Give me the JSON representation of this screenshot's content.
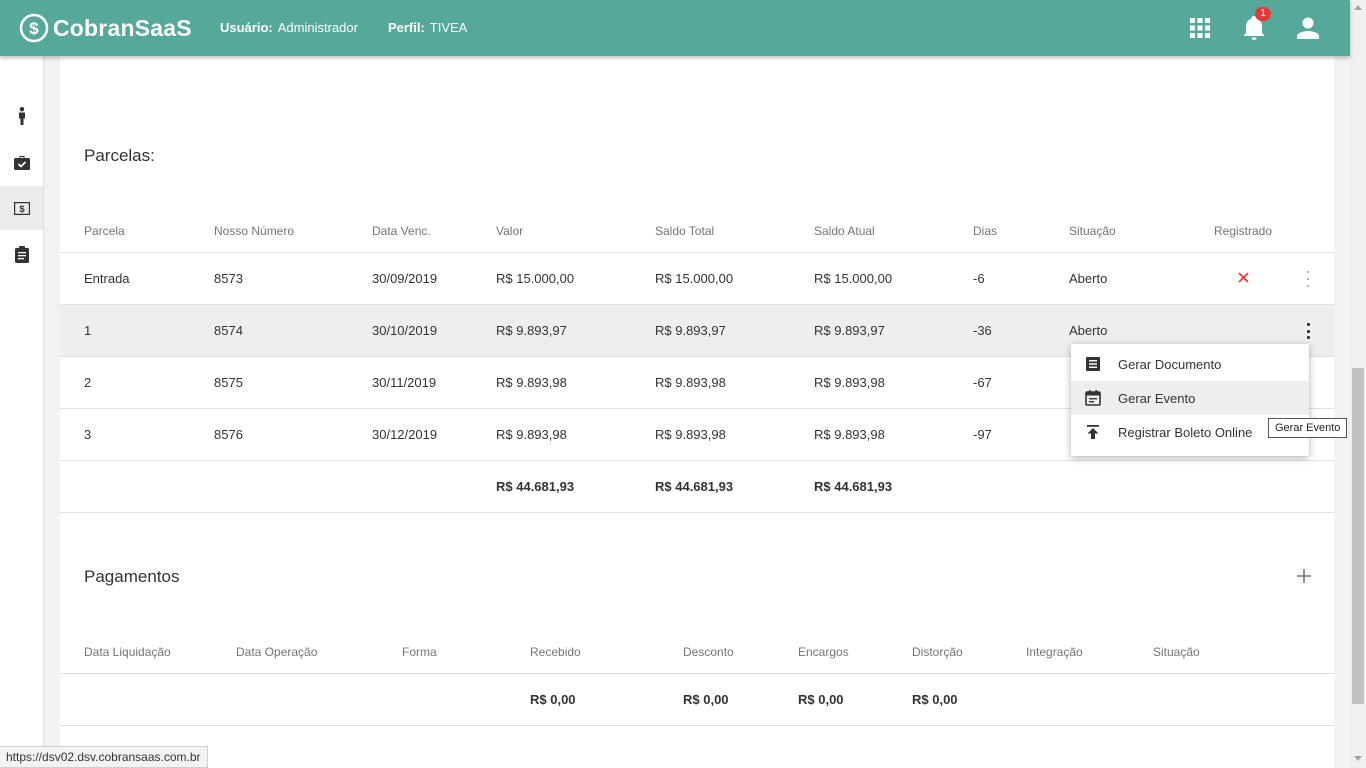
{
  "app": {
    "brand": "CobranSaaS",
    "user_label": "Usuário:",
    "user_value": "Administrador",
    "profile_label": "Perfil:",
    "profile_value": "TIVEA",
    "notifications_count": "1"
  },
  "colors": {
    "brand": "#56a89a",
    "badge": "#e53935",
    "error_x": "#e53935"
  },
  "sidebar": {
    "items": [
      {
        "icon": "person-icon"
      },
      {
        "icon": "briefcase-check-icon"
      },
      {
        "icon": "money-icon",
        "active": true
      },
      {
        "icon": "clipboard-icon"
      }
    ]
  },
  "parcelas": {
    "title": "Parcelas:",
    "headers": [
      "Parcela",
      "Nosso Número",
      "Data Venc.",
      "Valor",
      "Saldo Total",
      "Saldo Atual",
      "Dias",
      "Situação",
      "Registrado"
    ],
    "rows": [
      {
        "parcela": "Entrada",
        "nosso_numero": "8573",
        "data_venc": "30/09/2019",
        "valor": "R$ 15.000,00",
        "saldo_total": "R$ 15.000,00",
        "saldo_atual": "R$ 15.000,00",
        "dias": "-6",
        "situacao": "Aberto",
        "registrado_icon": "close-icon"
      },
      {
        "parcela": "1",
        "nosso_numero": "8574",
        "data_venc": "30/10/2019",
        "valor": "R$ 9.893,97",
        "saldo_total": "R$ 9.893,97",
        "saldo_atual": "R$ 9.893,97",
        "dias": "-36",
        "situacao": "Aberto"
      },
      {
        "parcela": "2",
        "nosso_numero": "8575",
        "data_venc": "30/11/2019",
        "valor": "R$ 9.893,98",
        "saldo_total": "R$ 9.893,98",
        "saldo_atual": "R$ 9.893,98",
        "dias": "-67",
        "situacao": ""
      },
      {
        "parcela": "3",
        "nosso_numero": "8576",
        "data_venc": "30/12/2019",
        "valor": "R$ 9.893,98",
        "saldo_total": "R$ 9.893,98",
        "saldo_atual": "R$ 9.893,98",
        "dias": "-97",
        "situacao": ""
      }
    ],
    "totals": {
      "valor": "R$ 44.681,93",
      "saldo_total": "R$ 44.681,93",
      "saldo_atual": "R$ 44.681,93"
    }
  },
  "menu": {
    "items": [
      {
        "label": "Gerar Documento",
        "icon": "document-icon"
      },
      {
        "label": "Gerar Evento",
        "icon": "event-icon"
      },
      {
        "label": "Registrar Boleto Online",
        "icon": "upload-icon"
      }
    ],
    "tooltip": "Gerar Evento"
  },
  "pagamentos": {
    "title": "Pagamentos",
    "headers": [
      "Data Liquidação",
      "Data Operação",
      "Forma",
      "Recebido",
      "Desconto",
      "Encargos",
      "Distorção",
      "Integração",
      "Situação"
    ],
    "totals": {
      "recebido": "R$ 0,00",
      "desconto": "R$ 0,00",
      "encargos": "R$ 0,00",
      "distorcao": "R$ 0,00"
    }
  },
  "statusbar": {
    "url": "https://dsv02.dsv.cobransaas.com.br"
  }
}
